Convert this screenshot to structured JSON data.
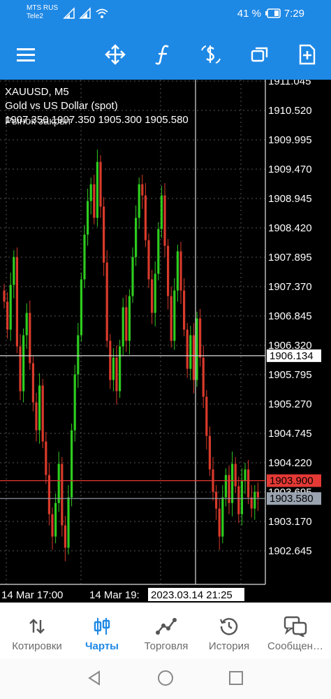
{
  "status": {
    "carrier_primary": "MTS RUS",
    "carrier_secondary": "Tele2",
    "battery": "41 %",
    "time": "7:29"
  },
  "toolbar": {
    "icons": [
      "menu-icon",
      "crosshair-move-icon",
      "indicators-icon",
      "symbol-dollar-icon",
      "timeframe-windows-icon",
      "new-order-icon"
    ]
  },
  "chart": {
    "symbol": "XAUUSD, M5",
    "description": "Gold vs US Dollar (spot)",
    "ohlc": "1907.350 1907.350 1905.300 1905.580",
    "overlay_text": "Рынок закрыт",
    "price_labels": [
      "1911.045",
      "1910.520",
      "1909.995",
      "1909.470",
      "1908.945",
      "1908.420",
      "1907.895",
      "1907.370",
      "1906.845",
      "1906.320",
      "1905.795",
      "1905.270",
      "1904.745",
      "1904.220",
      "1903.695",
      "1903.170",
      "1902.645"
    ],
    "crosshair_price": "1906.134",
    "ask_price": "1903.900",
    "bid_price": "1903.580",
    "time_labels": [
      "14 Mar 17:00",
      "14 Mar 19:"
    ],
    "crosshair_time": "2023.03.14 21:25",
    "colors": {
      "bull": "#2ecc1f",
      "bear": "#d93a2b",
      "ask_line": "#e53935",
      "bid_line": "#9aa4b0",
      "grid": "#555555"
    }
  },
  "nav": {
    "items": [
      {
        "label": "Котировки",
        "icon": "quotes-arrows-icon"
      },
      {
        "label": "Чарты",
        "icon": "candles-chart-icon"
      },
      {
        "label": "Торговля",
        "icon": "trade-line-icon"
      },
      {
        "label": "История",
        "icon": "history-clock-icon"
      },
      {
        "label": "Сообщен…",
        "icon": "messages-chat-icon"
      }
    ]
  }
}
